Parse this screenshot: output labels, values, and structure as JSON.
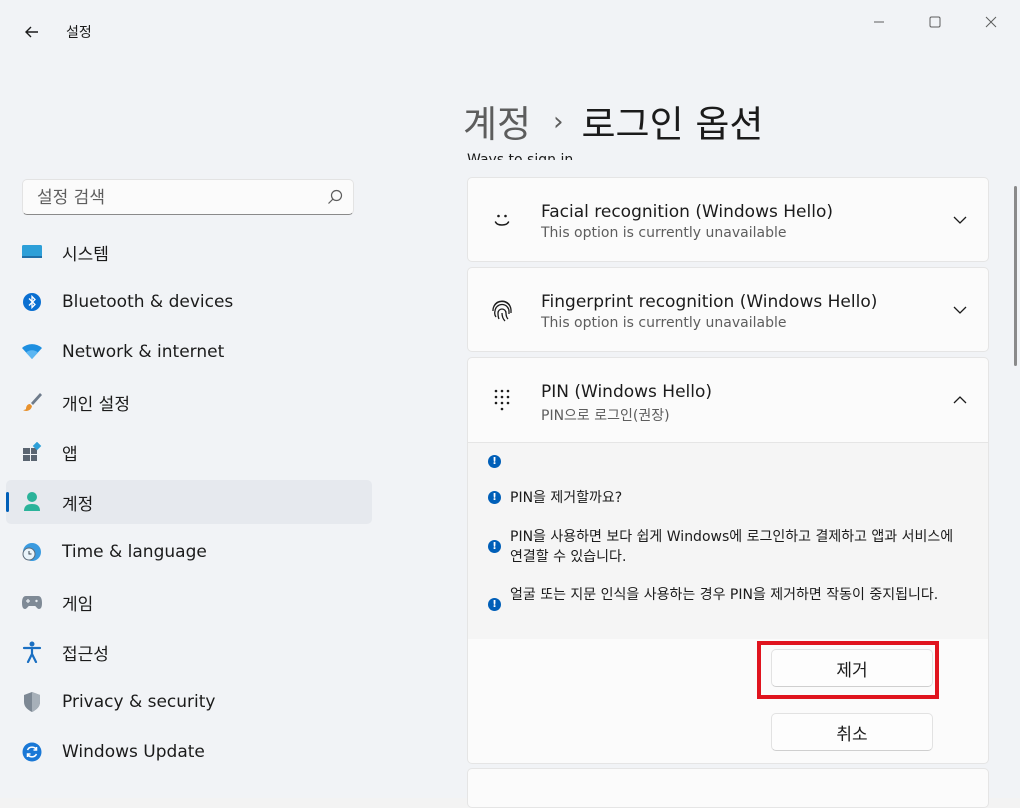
{
  "window": {
    "app_title": "설정",
    "controls": {
      "minimize": "minimize-icon",
      "maximize": "maximize-icon",
      "close": "close-icon"
    }
  },
  "sidebar": {
    "search_placeholder": "설정 검색",
    "items": [
      {
        "label": "시스템",
        "icon": "system-icon",
        "active": false
      },
      {
        "label": "Bluetooth & devices",
        "icon": "bluetooth-icon",
        "active": false
      },
      {
        "label": "Network & internet",
        "icon": "wifi-icon",
        "active": false
      },
      {
        "label": "개인 설정",
        "icon": "paintbrush-icon",
        "active": false
      },
      {
        "label": "앱",
        "icon": "apps-icon",
        "active": false
      },
      {
        "label": "계정",
        "icon": "account-icon",
        "active": true
      },
      {
        "label": "Time & language",
        "icon": "globe-clock-icon",
        "active": false
      },
      {
        "label": "게임",
        "icon": "gamepad-icon",
        "active": false
      },
      {
        "label": "접근성",
        "icon": "accessibility-icon",
        "active": false
      },
      {
        "label": "Privacy & security",
        "icon": "shield-icon",
        "active": false
      },
      {
        "label": "Windows Update",
        "icon": "update-icon",
        "active": false
      }
    ]
  },
  "main": {
    "breadcrumb": {
      "parent": "계정",
      "separator": "›",
      "current": "로그인 옵션"
    },
    "section_heading": "Ways to sign in",
    "cards": {
      "facial": {
        "title": "Facial recognition (Windows Hello)",
        "subtitle": "This option is currently unavailable"
      },
      "fingerprint": {
        "title": "Fingerprint recognition (Windows Hello)",
        "subtitle": "This option is currently unavailable"
      },
      "pin": {
        "title": "PIN (Windows Hello)",
        "subtitle": "PIN으로 로그인(권장)",
        "info_lines": [
          "",
          "PIN을 제거할까요?",
          "PIN을 사용하면 보다 쉽게 Windows에 로그인하고 결제하고 앱과 서비스에 연결할 수 있습니다.",
          "얼굴 또는 지문 인식을 사용하는 경우 PIN을 제거하면 작동이 중지됩니다."
        ],
        "remove_button": "제거",
        "cancel_button": "취소"
      }
    }
  },
  "colors": {
    "accent": "#005fb8",
    "highlight": "#e0141e"
  }
}
